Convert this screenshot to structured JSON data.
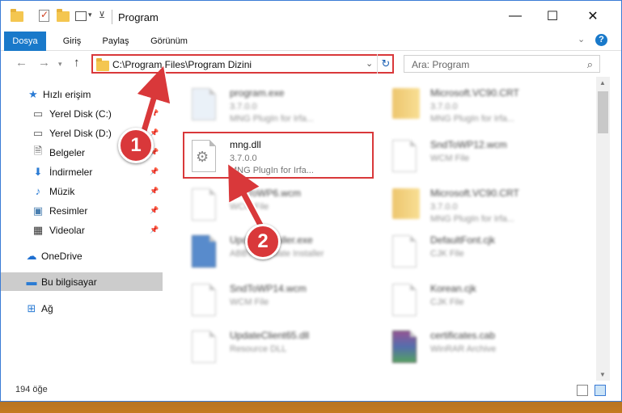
{
  "window": {
    "title": "Program"
  },
  "ribbon": {
    "tabs": [
      "Dosya",
      "Giriş",
      "Paylaş",
      "Görünüm"
    ],
    "help": "?"
  },
  "address": {
    "path": "C:\\Program Files\\Program Dizini"
  },
  "search": {
    "placeholder": "Ara: Program"
  },
  "sidebar": {
    "items": [
      {
        "label": "Hızlı erişim",
        "icon": "star-icon"
      },
      {
        "label": "Yerel Disk (C:)",
        "icon": "drive-icon"
      },
      {
        "label": "Yerel Disk (D:)",
        "icon": "drive-icon"
      },
      {
        "label": "Belgeler",
        "icon": "documents-icon"
      },
      {
        "label": "İndirmeler",
        "icon": "download-icon"
      },
      {
        "label": "Müzik",
        "icon": "music-icon"
      },
      {
        "label": "Resimler",
        "icon": "pictures-icon"
      },
      {
        "label": "Videolar",
        "icon": "video-icon"
      },
      {
        "label": "OneDrive",
        "icon": "cloud-icon"
      },
      {
        "label": "Bu bilgisayar",
        "icon": "computer-icon"
      },
      {
        "label": "Ağ",
        "icon": "network-icon"
      }
    ]
  },
  "files": [
    {
      "name": "program.exe",
      "line2": "3.7.0.0",
      "line3": "MNG PlugIn for Irfa..."
    },
    {
      "name": "Microsoft.VC90.CRT",
      "line2": "3.7.0.0",
      "line3": "MNG PlugIn for Irfa..."
    },
    {
      "name": "mng.dll",
      "line2": "3.7.0.0",
      "line3": "MNG PlugIn for Irfa..."
    },
    {
      "name": "SndToWP12.wcm",
      "line2": "WCM File",
      "line3": ""
    },
    {
      "name": "SndToWP6.wcm",
      "line2": "WCM File",
      "line3": ""
    },
    {
      "name": "Microsoft.VC90.CRT",
      "line2": "3.7.0.0",
      "line3": "MNG PlugIn for Irfa..."
    },
    {
      "name": "UpdateInstaller.exe",
      "line2": "ABBYY Update Installer",
      "line3": ""
    },
    {
      "name": "DefaultFont.cjk",
      "line2": "CJK File",
      "line3": ""
    },
    {
      "name": "SndToWP14.wcm",
      "line2": "WCM File",
      "line3": ""
    },
    {
      "name": "Korean.cjk",
      "line2": "CJK File",
      "line3": ""
    },
    {
      "name": "UpdateClient65.dll",
      "line2": "Resource DLL",
      "line3": ""
    },
    {
      "name": "certificates.cab",
      "line2": "WinRAR Archive",
      "line3": ""
    }
  ],
  "status": {
    "count": "194 öğe"
  },
  "callouts": {
    "one": "1",
    "two": "2"
  },
  "colors": {
    "accent": "#1979ca",
    "highlight": "#d9383a"
  }
}
